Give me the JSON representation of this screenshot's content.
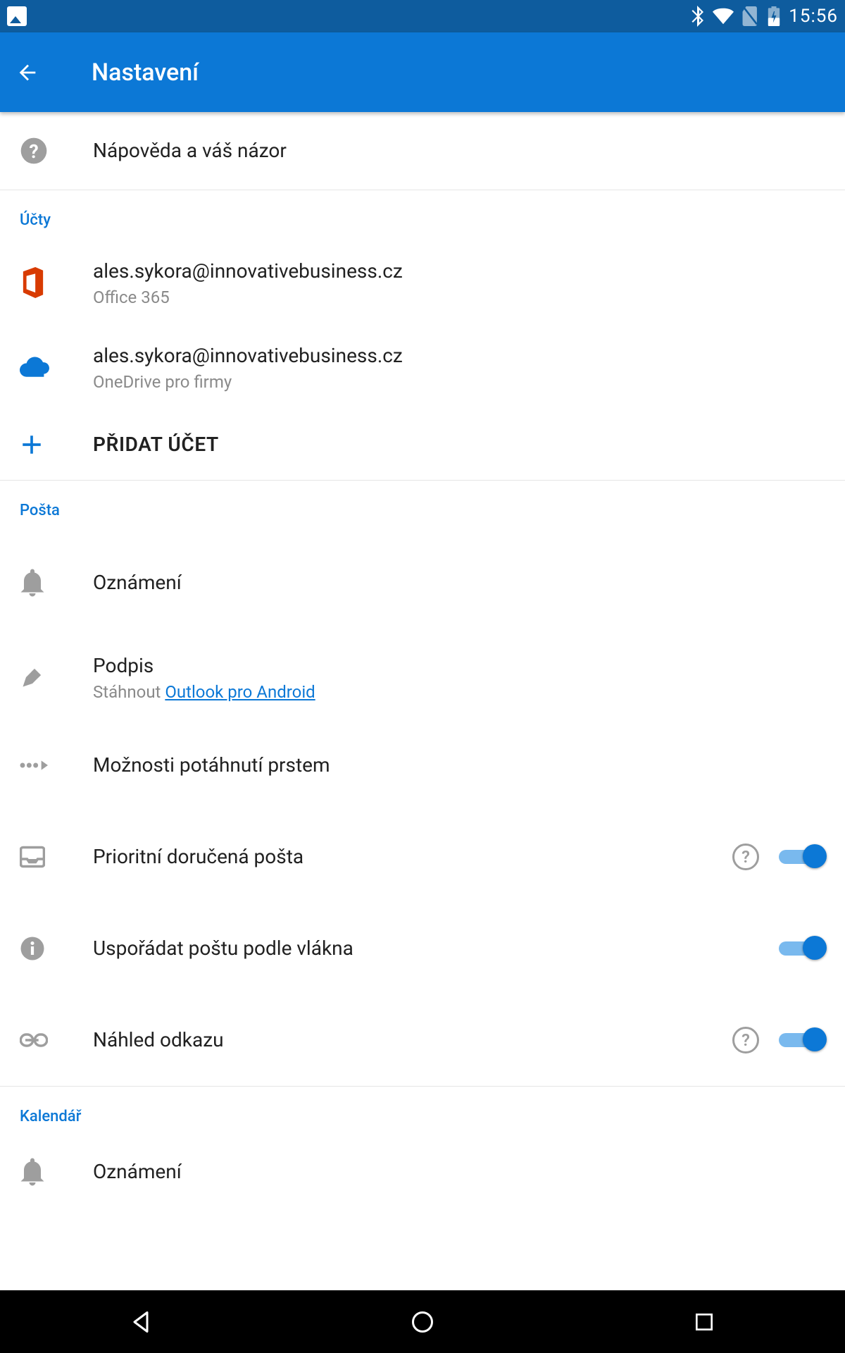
{
  "status": {
    "time": "15:56"
  },
  "appbar": {
    "title": "Nastavení"
  },
  "help": {
    "label": "Nápověda a váš názor"
  },
  "sections": {
    "accounts": "Účty",
    "mail": "Pošta",
    "calendar": "Kalendář"
  },
  "accounts": [
    {
      "email": "ales.sykora@innovativebusiness.cz",
      "type": "Office 365"
    },
    {
      "email": "ales.sykora@innovativebusiness.cz",
      "type": "OneDrive pro firmy"
    }
  ],
  "addAccount": "PŘIDAT ÚČET",
  "mail": {
    "notifications": "Oznámení",
    "signature": {
      "title": "Podpis",
      "prefix": "Stáhnout ",
      "link": "Outlook pro Android"
    },
    "swipe": "Možnosti potáhnutí prstem",
    "focused": "Prioritní doručená pošta",
    "thread": "Uspořádat poštu podle vlákna",
    "linkpreview": "Náhled odkazu"
  },
  "calendar": {
    "notifications": "Oznámení"
  }
}
